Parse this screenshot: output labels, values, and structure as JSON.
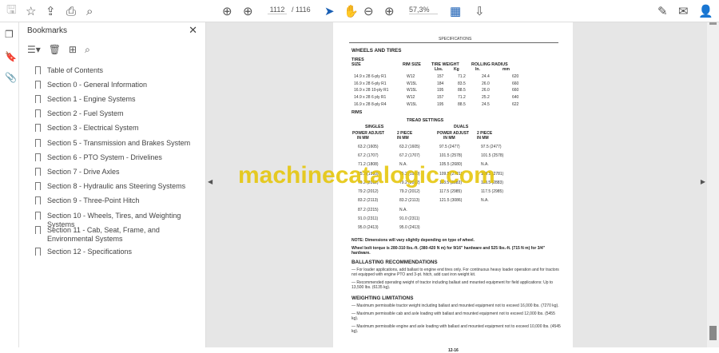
{
  "toolbar": {
    "page_current": "1112",
    "page_total": "/ 1116",
    "zoom": "57,3%"
  },
  "bookmarks": {
    "title": "Bookmarks",
    "items": [
      "Table of Contents",
      "Section 0 - General Information",
      "Section 1 - Engine Systems",
      "Section 2 - Fuel System",
      "Section 3 - Electrical System",
      "Section 5 - Transmission and Brakes System",
      "Section 6 - PTO System - Drivelines",
      "Section 7 - Drive Axles",
      "Section 8 - Hydraulic ans Steering Systems",
      "Section 9 - Three-Point Hitch",
      "Section 10 - Wheels, Tires, and Weighting Systems",
      "Section 11 - Cab, Seat, Frame, and Environmental Systems",
      "Section 12 - Specifications"
    ]
  },
  "doc": {
    "header": "SPECIFICATIONS",
    "wheels_title": "WHEELS AND TIRES",
    "tires_head": {
      "c1a": "TIRES",
      "c1b": "SIZE",
      "c2": "RIM SIZE",
      "c3": "TIRE WEIGHT",
      "c3a": "Lbs.",
      "c3b": "Kg",
      "c4": "ROLLING RADIUS",
      "c4a": "In.",
      "c4b": "mm"
    },
    "tires": [
      [
        "14.9 x 28 6-ply R1",
        "W12",
        "157",
        "71.2",
        "24.4",
        "620"
      ],
      [
        "16.9 x 28 6-ply R1",
        "W15L",
        "184",
        "83.5",
        "26.0",
        "660"
      ],
      [
        "16.9 x 28 10-ply R1",
        "W15L",
        "195",
        "88.5",
        "26.0",
        "660"
      ],
      [
        "14.9 x 28 6 ply R1",
        "W12",
        "157",
        "71.2",
        "25.2",
        "640"
      ],
      [
        "16.9 x 28 8-ply R4",
        "W15L",
        "195",
        "88.5",
        "24.5",
        "622"
      ]
    ],
    "rims": "RIMS",
    "tread": "TREAD SETTINGS",
    "singles": "SINGLES",
    "duals": "DUALS",
    "pa": "POWER ADJUST",
    "tp": "2 PIECE",
    "inmm": "IN    MM",
    "singles_rows": [
      [
        "63.2 (1605)",
        "63.2 (1605)"
      ],
      [
        "67.2 (1707)",
        "67.2 (1707)"
      ],
      [
        "71.2 (1808)",
        "N.A."
      ],
      [
        "75.2 (1910)",
        "75.2 (1910)"
      ],
      [
        "79.2 (2012)",
        "79.2 (2012)"
      ],
      [
        "79.2 (2012)",
        "79.2 (2012)"
      ],
      [
        "83.2 (2113)",
        "83.2 (2113)"
      ],
      [
        "87.2 (2215)",
        "N.A."
      ],
      [
        "91.0 (2311)",
        "91.0 (2311)"
      ],
      [
        "95.0 (2413)",
        "95.0 (2413)"
      ]
    ],
    "duals_rows": [
      [
        "97.5 (2477)",
        "97.5 (2477)"
      ],
      [
        "101.5 (2578)",
        "101.5 (2578)"
      ],
      [
        "105.5 (2680)",
        "N.A."
      ],
      [
        "109.5 (2781)",
        "109.5 (2781)"
      ],
      [
        "113.5 (2883)",
        "113.5 (2883)"
      ],
      [
        "117.5 (2985)",
        "117.5 (2985)"
      ],
      [
        "121.5 (3086)",
        "N.A."
      ]
    ],
    "note": "NOTE: Dimensions will vary slightly depending on type of wheel.",
    "torque": "Wheel bolt torque is 280-310 lbs.-ft. (380-420 N m) for 9/16\" hardware and 525 lbs.-ft. (715 N m) for 3/4\" hardware.",
    "ballast_title": "BALLASTING RECOMMENDATIONS",
    "ballast": [
      "— For loader applications, add ballast to engine end tires only. For continuous heavy loader operation and for tractors not equipped with engine PTO and 3-pt. hitch, add cast iron weight kit.",
      "— Recommended operating weight of tractor including ballast and mounted equipment for field applications: Up to 13,500 lbs. (6135 kg)."
    ],
    "weight_title": "WEIGHTING LIMITATIONS",
    "weight": [
      "— Maximum permissible tractor weight including ballast and mounted equipment not to exceed 16,000 lbs. (7270 kg).",
      "— Maximum permissible cab and axle loading with ballast and mounted equipment not to exceed 12,000 lbs. (5455 kg).",
      "— Maximum permissible engine and axle loading with ballast and mounted equipment not to exceed 10,000 lbs. (4545 kg)."
    ],
    "page_no": "12-16",
    "watermark": "machinecatalogic.com"
  }
}
